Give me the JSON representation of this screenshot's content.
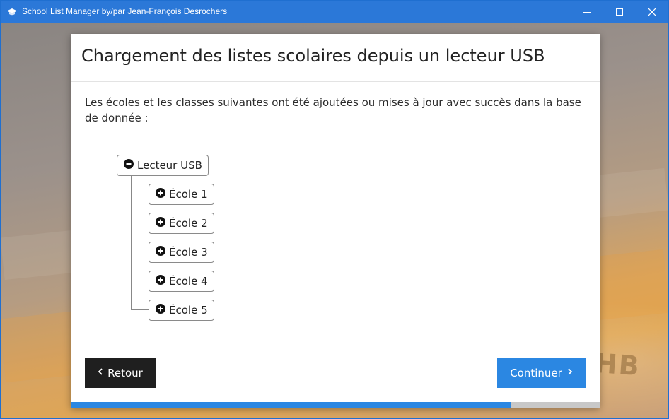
{
  "window": {
    "title": "School List Manager by/par Jean-François Desrochers",
    "icon": "graduation-cap-icon",
    "controls": [
      "minimize-icon",
      "maximize-icon",
      "close-icon"
    ],
    "accent_color": "#2b78d8"
  },
  "background": {
    "watermark_text": "HB"
  },
  "dialog": {
    "title": "Chargement des listes scolaires depuis un lecteur USB",
    "message": "Les écoles et les classes suivantes ont été ajoutées ou mises à jour avec succès dans la base de donnée :",
    "tree": {
      "root": {
        "label": "Lecteur USB",
        "icon": "minus-circle-icon",
        "expanded": true
      },
      "children": [
        {
          "label": "École 1",
          "icon": "plus-circle-icon",
          "expanded": false
        },
        {
          "label": "École 2",
          "icon": "plus-circle-icon",
          "expanded": false
        },
        {
          "label": "École 3",
          "icon": "plus-circle-icon",
          "expanded": false
        },
        {
          "label": "École 4",
          "icon": "plus-circle-icon",
          "expanded": false
        },
        {
          "label": "École 5",
          "icon": "plus-circle-icon",
          "expanded": false
        }
      ]
    },
    "buttons": {
      "back_label": "Retour",
      "back_icon": "chevron-left-icon",
      "back_color": "#1f1f1f",
      "next_label": "Continuer",
      "next_icon": "chevron-right-icon",
      "next_color": "#2b87e2"
    },
    "progress": {
      "fraction": 0.832,
      "fill_color": "#2b87e2",
      "track_color": "#c8c8c8"
    }
  }
}
